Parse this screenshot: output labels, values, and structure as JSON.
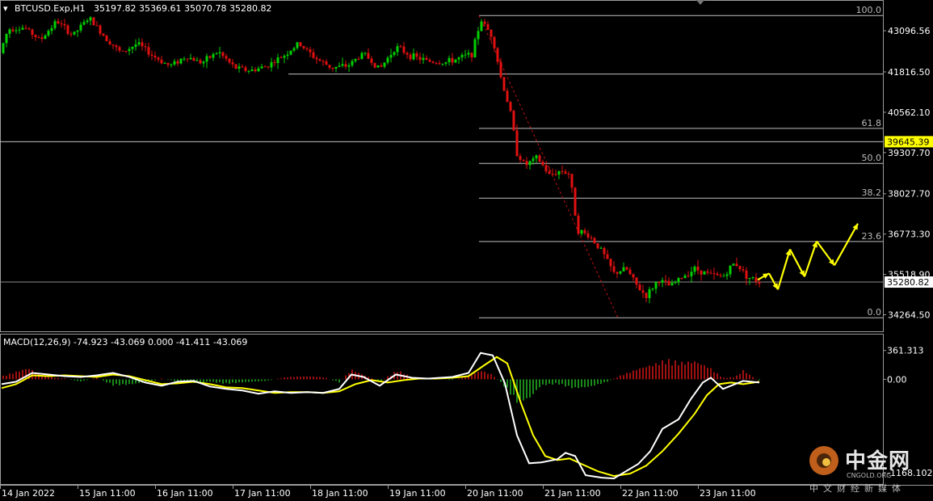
{
  "header": {
    "symbol": "BTCUSD.Exp,H1",
    "ohlc": "35197.82 35369.61 35070.78 35280.82",
    "macd_label": "MACD(12,26,9) -74.923 -43.069 0.000 -41.411 -43.069"
  },
  "colors": {
    "bull": "#00d000",
    "bear": "#e01010",
    "grid_line": "#c0c0c0",
    "macd_line": "#ffffff",
    "signal_line": "#ffff00",
    "fib_diag": "#c01010",
    "arrow": "#ffff00",
    "price_tag_bg": "#ffff00"
  },
  "watermark": {
    "logo": "中金网",
    "domain": "CNGOLD.ORG",
    "tagline": "中文财经新媒体"
  },
  "chart_data": [
    {
      "type": "candlestick",
      "panel": "price",
      "ylim": [
        33950,
        43600
      ],
      "y_ticks": [
        43096.56,
        41816.56,
        40562.1,
        39307.7,
        38027.7,
        36773.3,
        35518.9,
        34264.5
      ],
      "y_tick_labels": [
        "43096.56",
        "41816.50",
        "40562.10",
        "39307.70",
        "38027.70",
        "36773.30",
        "35518.90",
        "34264.50"
      ],
      "current_price": {
        "value": 35280.82,
        "label": "35280.82"
      },
      "highlight_level": {
        "value": 39645.39,
        "label": "39645.39"
      },
      "x_labels": [
        "14 Jan 2022",
        "15 Jan 11:00",
        "16 Jan 11:00",
        "17 Jan 11:00",
        "18 Jan 11:00",
        "19 Jan 11:00",
        "20 Jan 11:00",
        "21 Jan 11:00",
        "22 Jan 11:00",
        "23 Jan 11:00"
      ],
      "extra_level": 41750,
      "fibonacci": {
        "levels": [
          {
            "label": "100.0",
            "value": 43570
          },
          {
            "label": "61.8",
            "value": 40060
          },
          {
            "label": "50.0",
            "value": 38970
          },
          {
            "label": "38.2",
            "value": 37890
          },
          {
            "label": "23.6",
            "value": 36540
          },
          {
            "label": "0.0",
            "value": 34170
          }
        ]
      },
      "anchors": [
        [
          0,
          42400
        ],
        [
          10,
          43150
        ],
        [
          30,
          43200
        ],
        [
          50,
          42800
        ],
        [
          70,
          43400
        ],
        [
          90,
          42950
        ],
        [
          110,
          43500
        ],
        [
          130,
          42900
        ],
        [
          150,
          42400
        ],
        [
          170,
          42700
        ],
        [
          190,
          42300
        ],
        [
          210,
          42000
        ],
        [
          230,
          42300
        ],
        [
          250,
          42100
        ],
        [
          270,
          42450
        ],
        [
          290,
          41950
        ],
        [
          310,
          41850
        ],
        [
          330,
          42000
        ],
        [
          350,
          42300
        ],
        [
          370,
          42700
        ],
        [
          390,
          42250
        ],
        [
          410,
          41950
        ],
        [
          430,
          42000
        ],
        [
          450,
          42400
        ],
        [
          470,
          41900
        ],
        [
          490,
          42600
        ],
        [
          510,
          42300
        ],
        [
          530,
          42150
        ],
        [
          550,
          42100
        ],
        [
          570,
          42250
        ],
        [
          585,
          42400
        ],
        [
          595,
          43450
        ],
        [
          610,
          42900
        ],
        [
          620,
          41650
        ],
        [
          632,
          40550
        ],
        [
          640,
          39300
        ],
        [
          650,
          38900
        ],
        [
          665,
          39150
        ],
        [
          680,
          38600
        ],
        [
          695,
          38750
        ],
        [
          705,
          38650
        ],
        [
          715,
          36900
        ],
        [
          730,
          36700
        ],
        [
          745,
          36250
        ],
        [
          760,
          35550
        ],
        [
          775,
          35700
        ],
        [
          790,
          35100
        ],
        [
          800,
          34850
        ],
        [
          815,
          35350
        ],
        [
          830,
          35150
        ],
        [
          845,
          35450
        ],
        [
          860,
          35700
        ],
        [
          880,
          35500
        ],
        [
          895,
          35450
        ],
        [
          910,
          35900
        ],
        [
          925,
          35450
        ],
        [
          940,
          35280
        ]
      ],
      "forecast_arrows": [
        [
          938,
          35350
        ],
        [
          952,
          35550
        ],
        [
          963,
          35050
        ],
        [
          978,
          36300
        ],
        [
          996,
          35450
        ],
        [
          1011,
          36550
        ],
        [
          1033,
          35800
        ],
        [
          1062,
          37100
        ]
      ]
    },
    {
      "type": "macd",
      "panel": "indicator",
      "ylim": [
        -1300,
        520
      ],
      "y_ticks": [
        361.313,
        0.0,
        -1168.102
      ],
      "y_tick_labels": [
        "361.313",
        "0.00",
        "-1168.102"
      ],
      "macd_line": [
        [
          2,
          -60
        ],
        [
          20,
          -30
        ],
        [
          40,
          80
        ],
        [
          60,
          60
        ],
        [
          80,
          40
        ],
        [
          100,
          30
        ],
        [
          120,
          50
        ],
        [
          140,
          80
        ],
        [
          160,
          30
        ],
        [
          180,
          -40
        ],
        [
          200,
          -80
        ],
        [
          220,
          -30
        ],
        [
          240,
          -20
        ],
        [
          260,
          -90
        ],
        [
          280,
          -120
        ],
        [
          300,
          -140
        ],
        [
          320,
          -180
        ],
        [
          340,
          -150
        ],
        [
          360,
          -170
        ],
        [
          380,
          -160
        ],
        [
          400,
          -170
        ],
        [
          420,
          -120
        ],
        [
          435,
          60
        ],
        [
          450,
          30
        ],
        [
          470,
          -80
        ],
        [
          490,
          60
        ],
        [
          510,
          20
        ],
        [
          530,
          10
        ],
        [
          560,
          30
        ],
        [
          580,
          80
        ],
        [
          595,
          330
        ],
        [
          610,
          300
        ],
        [
          625,
          -50
        ],
        [
          640,
          -700
        ],
        [
          655,
          -1050
        ],
        [
          670,
          -1040
        ],
        [
          690,
          -1000
        ],
        [
          700,
          -920
        ],
        [
          712,
          -960
        ],
        [
          725,
          -1200
        ],
        [
          745,
          -1230
        ],
        [
          760,
          -1240
        ],
        [
          775,
          -1150
        ],
        [
          790,
          -1060
        ],
        [
          805,
          -900
        ],
        [
          820,
          -620
        ],
        [
          840,
          -500
        ],
        [
          855,
          -250
        ],
        [
          870,
          -40
        ],
        [
          880,
          20
        ],
        [
          895,
          -120
        ],
        [
          905,
          -80
        ],
        [
          920,
          -20
        ],
        [
          940,
          -40
        ]
      ],
      "signal_line": [
        [
          2,
          -110
        ],
        [
          20,
          -60
        ],
        [
          40,
          50
        ],
        [
          60,
          40
        ],
        [
          80,
          50
        ],
        [
          100,
          40
        ],
        [
          120,
          30
        ],
        [
          140,
          60
        ],
        [
          160,
          40
        ],
        [
          180,
          -10
        ],
        [
          200,
          -60
        ],
        [
          220,
          -50
        ],
        [
          240,
          -30
        ],
        [
          260,
          -60
        ],
        [
          280,
          -100
        ],
        [
          300,
          -110
        ],
        [
          320,
          -140
        ],
        [
          340,
          -170
        ],
        [
          360,
          -160
        ],
        [
          380,
          -160
        ],
        [
          400,
          -170
        ],
        [
          420,
          -150
        ],
        [
          440,
          -60
        ],
        [
          460,
          -10
        ],
        [
          480,
          -40
        ],
        [
          500,
          -10
        ],
        [
          520,
          10
        ],
        [
          540,
          10
        ],
        [
          560,
          20
        ],
        [
          580,
          40
        ],
        [
          600,
          180
        ],
        [
          615,
          280
        ],
        [
          628,
          200
        ],
        [
          645,
          -300
        ],
        [
          660,
          -700
        ],
        [
          675,
          -960
        ],
        [
          690,
          -1010
        ],
        [
          705,
          -990
        ],
        [
          720,
          -1060
        ],
        [
          740,
          -1150
        ],
        [
          760,
          -1210
        ],
        [
          780,
          -1180
        ],
        [
          800,
          -1080
        ],
        [
          820,
          -900
        ],
        [
          840,
          -680
        ],
        [
          860,
          -430
        ],
        [
          875,
          -200
        ],
        [
          890,
          -60
        ],
        [
          905,
          -40
        ],
        [
          920,
          -60
        ],
        [
          940,
          -30
        ]
      ],
      "histogram_anchors": [
        [
          2,
          40
        ],
        [
          35,
          150
        ],
        [
          55,
          40
        ],
        [
          80,
          10
        ],
        [
          100,
          -30
        ],
        [
          120,
          20
        ],
        [
          140,
          -80
        ],
        [
          160,
          -70
        ],
        [
          180,
          -40
        ],
        [
          200,
          10
        ],
        [
          220,
          -30
        ],
        [
          240,
          -50
        ],
        [
          260,
          -30
        ],
        [
          280,
          -60
        ],
        [
          300,
          -40
        ],
        [
          330,
          -20
        ],
        [
          355,
          30
        ],
        [
          380,
          40
        ],
        [
          400,
          30
        ],
        [
          420,
          -40
        ],
        [
          435,
          130
        ],
        [
          450,
          60
        ],
        [
          470,
          -30
        ],
        [
          492,
          120
        ],
        [
          510,
          30
        ],
        [
          530,
          10
        ],
        [
          560,
          -10
        ],
        [
          580,
          40
        ],
        [
          595,
          120
        ],
        [
          610,
          60
        ],
        [
          625,
          -100
        ],
        [
          640,
          -300
        ],
        [
          655,
          -260
        ],
        [
          670,
          -80
        ],
        [
          690,
          -60
        ],
        [
          710,
          -120
        ],
        [
          730,
          -100
        ],
        [
          750,
          -40
        ],
        [
          770,
          60
        ],
        [
          790,
          140
        ],
        [
          810,
          200
        ],
        [
          825,
          260
        ],
        [
          845,
          220
        ],
        [
          860,
          240
        ],
        [
          878,
          160
        ],
        [
          895,
          20
        ],
        [
          910,
          30
        ],
        [
          920,
          120
        ],
        [
          935,
          10
        ],
        [
          940,
          -10
        ]
      ]
    }
  ]
}
